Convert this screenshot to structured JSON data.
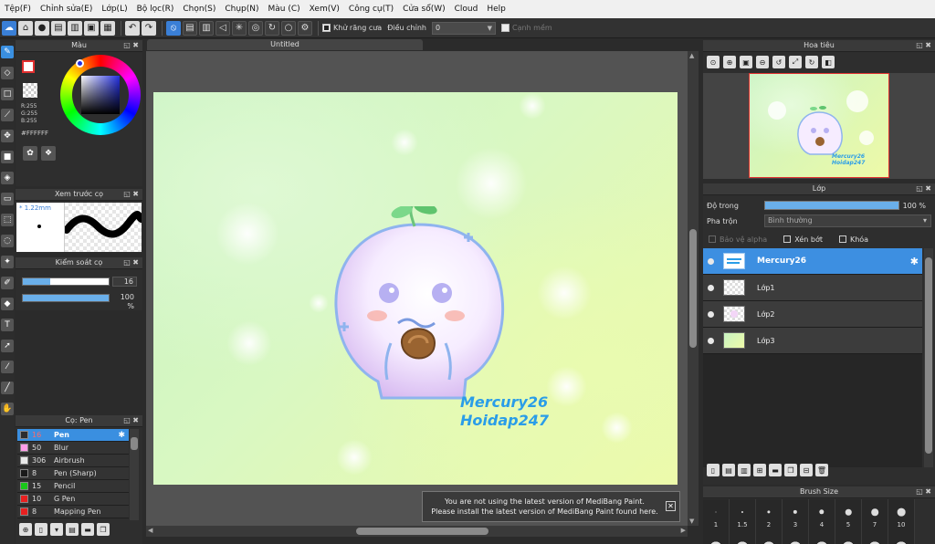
{
  "menu": [
    "Tệp(F)",
    "Chỉnh sửa(E)",
    "Lớp(L)",
    "Bộ lọc(R)",
    "Chọn(S)",
    "Chụp(N)",
    "Màu (C)",
    "Xem(V)",
    "Công cụ(T)",
    "Cửa sổ(W)",
    "Cloud",
    "Help"
  ],
  "toolbar": {
    "antialias_label": "Khử răng cưa",
    "correction_label": "Điều chỉnh",
    "correction_value": "0",
    "soft_edge_label": "Cạnh mềm"
  },
  "color_panel": {
    "title": "Màu",
    "r": "R:255",
    "g": "G:255",
    "b": "B:255",
    "hex": "#FFFFFF",
    "fg_color": "#ffffff",
    "accent": "#e23030"
  },
  "preview_panel": {
    "title": "Xem trước cọ",
    "size": "* 1.22mm"
  },
  "control_panel": {
    "title": "Kiểm soát cọ",
    "size_value": "16",
    "size_fraction": 0.32,
    "opacity_value": "100 %",
    "opacity_fraction": 1.0
  },
  "brush_panel": {
    "title": "Cọ: Pen",
    "brushes": [
      {
        "size": "16",
        "name": "Pen",
        "color": "#2d2d2d",
        "selected": true
      },
      {
        "size": "50",
        "name": "Blur",
        "color": "#ff9de8",
        "selected": false
      },
      {
        "size": "306",
        "name": "Airbrush",
        "color": "#e9e9e9",
        "selected": false
      },
      {
        "size": "8",
        "name": "Pen (Sharp)",
        "color": "#1a1a1a",
        "selected": false
      },
      {
        "size": "15",
        "name": "Pencil",
        "color": "#19c719",
        "selected": false
      },
      {
        "size": "10",
        "name": "G Pen",
        "color": "#e82020",
        "selected": false
      },
      {
        "size": "8",
        "name": "Mapping Pen",
        "color": "#e82020",
        "selected": false
      }
    ]
  },
  "document": {
    "tab_title": "Untitled",
    "signature_line1": "Mercury26",
    "signature_line2": "Hoidap247"
  },
  "notice": {
    "line1": "You are not using the latest version of MediBang Paint.",
    "line2": "Please install the latest version of MediBang Paint found here.",
    "close": "✕"
  },
  "navigator": {
    "title": "Hoa tiêu"
  },
  "layer_panel": {
    "title": "Lớp",
    "opacity_label": "Độ trong",
    "opacity_value": "100 %",
    "opacity_fraction": 1.0,
    "blend_label": "Pha trộn",
    "blend_value": "Bình thường",
    "protect_alpha": "Bảo vệ alpha",
    "clipping": "Xén bớt",
    "lock": "Khóa",
    "layers": [
      {
        "name": "Mercury26",
        "selected": true
      },
      {
        "name": "Lớp1",
        "selected": false
      },
      {
        "name": "Lớp2",
        "selected": false
      },
      {
        "name": "Lớp3",
        "selected": false
      }
    ]
  },
  "size_panel": {
    "title": "Brush Size",
    "sizes": [
      "1",
      "1.5",
      "2",
      "3",
      "4",
      "5",
      "7",
      "10"
    ]
  },
  "icons": {
    "pen": "pen-icon",
    "eraser": "eraser-icon",
    "gear": "gear-icon",
    "close": "close-icon"
  }
}
